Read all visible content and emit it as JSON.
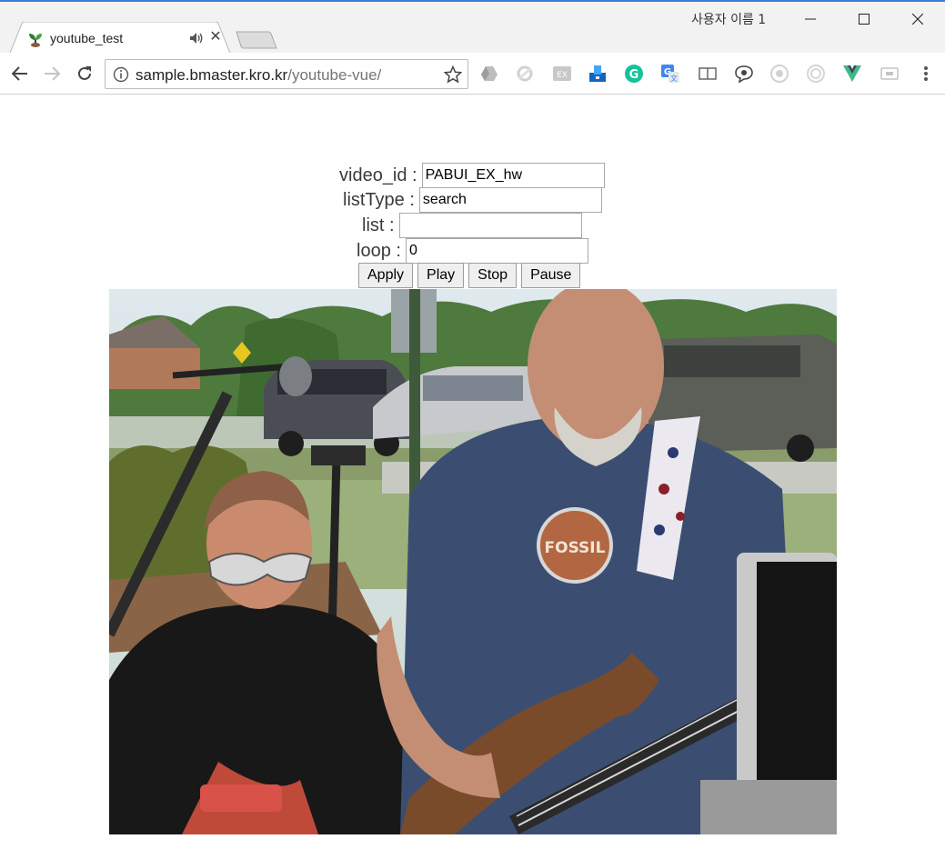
{
  "browser": {
    "tab": {
      "title": "youtube_test",
      "close": "✕"
    },
    "profile_name": "사용자 이름 1",
    "url": {
      "host": "sample.bmaster.kro.kr",
      "path": "/youtube-vue/"
    },
    "extensions": [
      "drive-icon",
      "sync-icon",
      "ex-icon",
      "clipper-icon",
      "grammarly-icon",
      "translate-icon",
      "reader-icon",
      "chat-icon",
      "shield-icon",
      "target-icon",
      "vue-devtools-icon",
      "cast-icon"
    ]
  },
  "form": {
    "video_id": {
      "label": "video_id :",
      "value": "PABUI_EX_hw"
    },
    "listType": {
      "label": "listType :",
      "value": "search"
    },
    "list": {
      "label": "list :",
      "value": ""
    },
    "loop": {
      "label": "loop :",
      "value": "0"
    }
  },
  "buttons": {
    "apply": "Apply",
    "play": "Play",
    "stop": "Stop",
    "pause": "Pause"
  },
  "player": {
    "logo": "FOSSIL"
  }
}
